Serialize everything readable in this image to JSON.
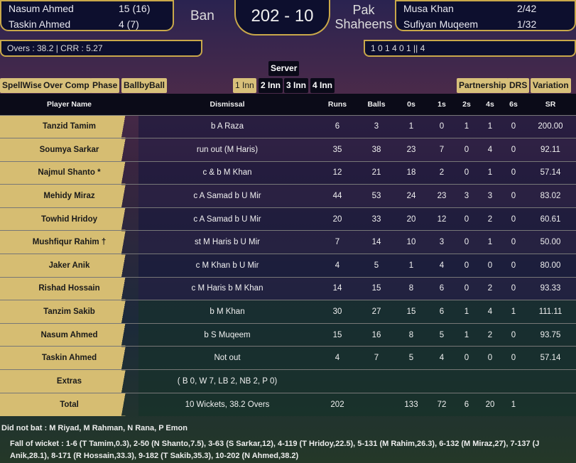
{
  "header": {
    "batters": [
      {
        "name": "Nasum Ahmed",
        "score": "15 (16)"
      },
      {
        "name": "Taskin Ahmed",
        "score": "4 (7)"
      }
    ],
    "team_left": "Ban",
    "score": "202 - 10",
    "team_right": "Pak Shaheens",
    "bowlers": [
      {
        "name": "Musa Khan",
        "figures": "2/42"
      },
      {
        "name": "Sufiyan Muqeem",
        "figures": "1/32"
      }
    ],
    "overs_crr": "Overs : 38.2 | CRR : 5.27",
    "recent": "1 0 1 4 0 1 || 4"
  },
  "controls": {
    "server": "Server",
    "left_buttons": [
      "SpellWise",
      "Over Comp",
      "Phase",
      "BallbyBall"
    ],
    "innings": [
      "1 Inn",
      "2 Inn",
      "3 Inn",
      "4 Inn"
    ],
    "right_buttons": [
      "Partnership",
      "DRS",
      "Variation"
    ]
  },
  "table": {
    "headers": [
      "Player Name",
      "Dismissal",
      "Runs",
      "Balls",
      "0s",
      "1s",
      "2s",
      "4s",
      "6s",
      "SR"
    ],
    "rows": [
      [
        "Tanzid Tamim",
        "b A Raza",
        "6",
        "3",
        "1",
        "0",
        "1",
        "1",
        "0",
        "200.00"
      ],
      [
        "Soumya Sarkar",
        "run out (M Haris)",
        "35",
        "38",
        "23",
        "7",
        "0",
        "4",
        "0",
        "92.11"
      ],
      [
        "Najmul Shanto *",
        "c & b M Khan",
        "12",
        "21",
        "18",
        "2",
        "0",
        "1",
        "0",
        "57.14"
      ],
      [
        "Mehidy Miraz",
        "c A Samad b U Mir",
        "44",
        "53",
        "24",
        "23",
        "3",
        "3",
        "0",
        "83.02"
      ],
      [
        "Towhid Hridoy",
        "c A Samad b U Mir",
        "20",
        "33",
        "20",
        "12",
        "0",
        "2",
        "0",
        "60.61"
      ],
      [
        "Mushfiqur Rahim †",
        "st M Haris b U Mir",
        "7",
        "14",
        "10",
        "3",
        "0",
        "1",
        "0",
        "50.00"
      ],
      [
        "Jaker Anik",
        "c M Khan b U Mir",
        "4",
        "5",
        "1",
        "4",
        "0",
        "0",
        "0",
        "80.00"
      ],
      [
        "Rishad Hossain",
        "c M Haris b M Khan",
        "14",
        "15",
        "8",
        "6",
        "0",
        "2",
        "0",
        "93.33"
      ],
      [
        "Tanzim Sakib",
        "b M Khan",
        "30",
        "27",
        "15",
        "6",
        "1",
        "4",
        "1",
        "111.11"
      ],
      [
        "Nasum Ahmed",
        "b S Muqeem",
        "15",
        "16",
        "8",
        "5",
        "1",
        "2",
        "0",
        "93.75"
      ],
      [
        "Taskin Ahmed",
        "Not out",
        "4",
        "7",
        "5",
        "4",
        "0",
        "0",
        "0",
        "57.14"
      ],
      [
        "Extras",
        "( B 0, W 7, LB 2, NB 2, P 0)",
        "",
        "",
        "",
        "",
        "",
        "",
        "",
        ""
      ],
      [
        "Total",
        "10 Wickets, 38.2 Overs",
        "202",
        "",
        "133",
        "72",
        "6",
        "20",
        "1",
        ""
      ]
    ]
  },
  "did_not_bat": "Did not bat : M Riyad, M Rahman, N Rana, P Emon",
  "fall_of_wicket": "Fall of wicket : 1-6 (T Tamim,0.3), 2-50 (N Shanto,7.5), 3-63 (S Sarkar,12), 4-119 (T Hridoy,22.5), 5-131 (M Rahim,26.3), 6-132 (M Miraz,27), 7-137 (J Anik,28.1), 8-171 (R Hossain,33.3), 9-182 (T Sakib,35.3), 10-202 (N Ahmed,38.2)"
}
